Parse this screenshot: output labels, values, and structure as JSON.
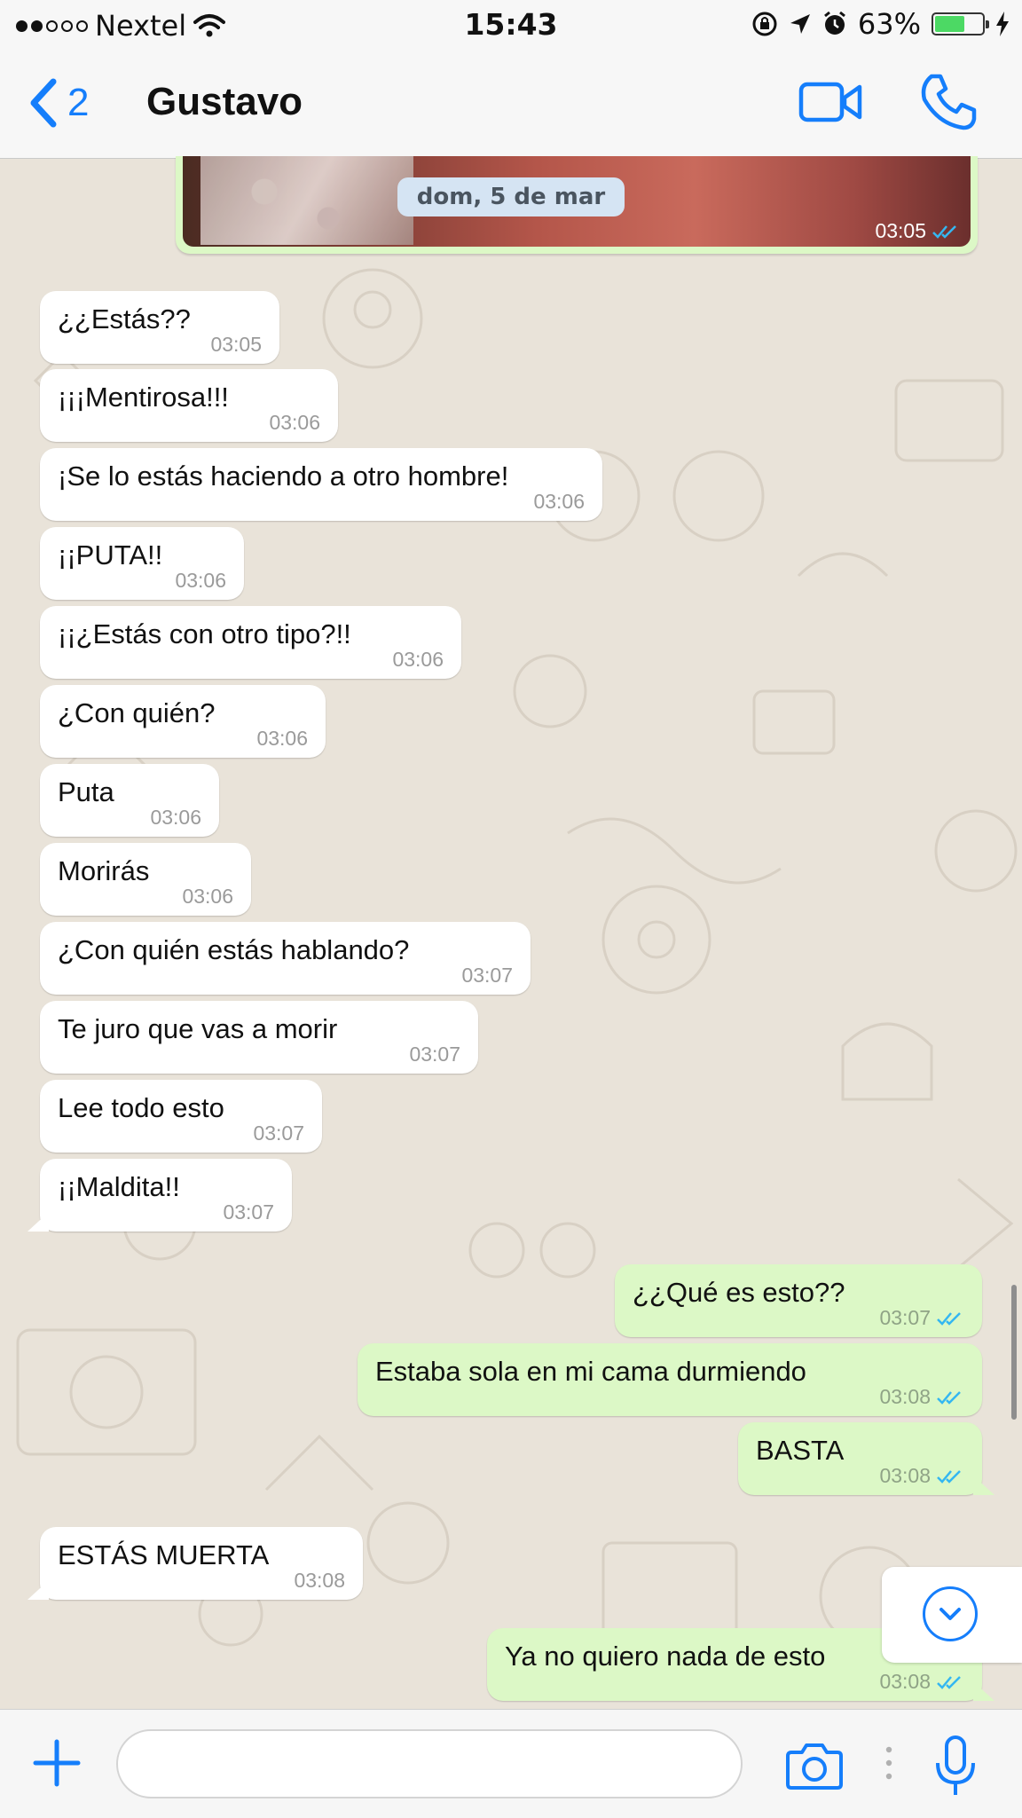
{
  "status_bar": {
    "carrier": "Nextel",
    "time": "15:43",
    "battery_percent": "63%",
    "battery_level": 0.63,
    "icons": [
      "signal-dots",
      "wifi-icon",
      "lock-rotation-icon",
      "location-icon",
      "alarm-icon",
      "battery-icon",
      "charging-icon"
    ]
  },
  "nav": {
    "back_count": "2",
    "contact_name": "Gustavo",
    "icons": [
      "chevron-left-icon",
      "video-call-icon",
      "phone-icon"
    ]
  },
  "media_message": {
    "time": "03:05",
    "read": true
  },
  "date_pill": "dom, 5 de mar",
  "messages": [
    {
      "dir": "in",
      "text": "¿¿Estás??",
      "time": "03:05"
    },
    {
      "dir": "in",
      "text": "¡¡¡Mentirosa!!!",
      "time": "03:06"
    },
    {
      "dir": "in",
      "text": "¡Se lo estás haciendo a otro hombre!",
      "time": "03:06"
    },
    {
      "dir": "in",
      "text": "¡¡PUTA!!",
      "time": "03:06"
    },
    {
      "dir": "in",
      "text": "¡¡¿Estás con otro tipo?!!",
      "time": "03:06"
    },
    {
      "dir": "in",
      "text": "¿Con quién?",
      "time": "03:06"
    },
    {
      "dir": "in",
      "text": "Puta",
      "time": "03:06"
    },
    {
      "dir": "in",
      "text": "Morirás",
      "time": "03:06"
    },
    {
      "dir": "in",
      "text": "¿Con quién estás hablando?",
      "time": "03:07"
    },
    {
      "dir": "in",
      "text": "Te juro que vas a morir",
      "time": "03:07"
    },
    {
      "dir": "in",
      "text": "Lee todo esto",
      "time": "03:07"
    },
    {
      "dir": "in",
      "text": "¡¡Maldita!!",
      "time": "03:07"
    },
    {
      "dir": "out",
      "text": "¿¿Qué es esto??",
      "time": "03:07"
    },
    {
      "dir": "out",
      "text": "Estaba sola en mi cama durmiendo",
      "time": "03:08"
    },
    {
      "dir": "out",
      "text": "BASTA",
      "time": "03:08"
    },
    {
      "dir": "in",
      "text": "ESTÁS MUERTA",
      "time": "03:08"
    },
    {
      "dir": "out",
      "text": "Ya no quiero nada de esto",
      "time": "03:08"
    }
  ],
  "input": {
    "placeholder": "",
    "value": ""
  },
  "input_icons": [
    "plus-icon",
    "camera-icon",
    "more-vertical-icon",
    "microphone-icon"
  ],
  "colors": {
    "accent": "#157efb",
    "outgoing_bubble": "#dcf8c6",
    "incoming_bubble": "#ffffff",
    "wallpaper": "#e9e3d9",
    "read_ticks": "#34b7f1"
  }
}
